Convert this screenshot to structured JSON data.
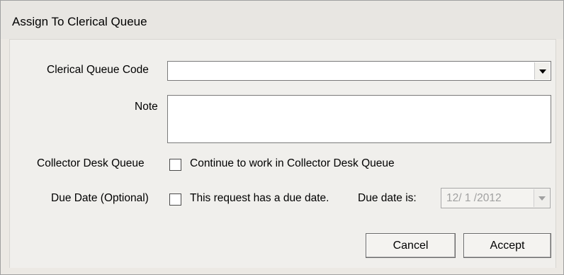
{
  "window": {
    "title": "Assign To Clerical Queue"
  },
  "form": {
    "queue_code": {
      "label": "Clerical Queue Code",
      "value": ""
    },
    "note": {
      "label": "Note",
      "value": ""
    },
    "collector_desk": {
      "label": "Collector Desk Queue",
      "checkbox_label": "Continue to work in Collector Desk Queue",
      "checked": false
    },
    "due_date": {
      "label": "Due Date (Optional)",
      "checkbox_label": "This request has a due date.",
      "date_label": "Due date is:",
      "date_value": "12/ 1 /2012",
      "checked": false
    }
  },
  "buttons": {
    "cancel": "Cancel",
    "accept": "Accept"
  }
}
